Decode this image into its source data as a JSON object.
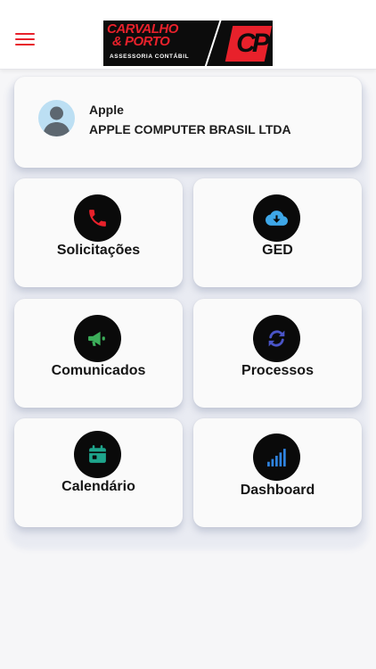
{
  "header": {
    "brand": {
      "name_line1": "CARVALHO",
      "name_line2": "& PORTO",
      "subtitle": "ASSESSORIA CONTÁBIL",
      "monogram": "CP",
      "brand_color": "#e8212b"
    },
    "menu_icon": "hamburger-menu-icon"
  },
  "user": {
    "name": "Apple",
    "company": "APPLE COMPUTER BRASIL LTDA",
    "avatar_icon": "user-placeholder-icon"
  },
  "tiles": [
    {
      "label": "Solicitações",
      "icon": "phone-icon",
      "icon_color": "#e8212b"
    },
    {
      "label": "GED",
      "icon": "cloud-download-icon",
      "icon_color": "#3ea7e8"
    },
    {
      "label": "Comunicados",
      "icon": "megaphone-icon",
      "icon_color": "#3cae5a"
    },
    {
      "label": "Processos",
      "icon": "sync-icon",
      "icon_color": "#4a55c8"
    },
    {
      "label": "Calendário",
      "icon": "calendar-icon",
      "icon_color": "#1ea58c"
    },
    {
      "label": "Dashboard",
      "icon": "signal-bars-icon",
      "icon_color": "#2f84e0"
    }
  ]
}
